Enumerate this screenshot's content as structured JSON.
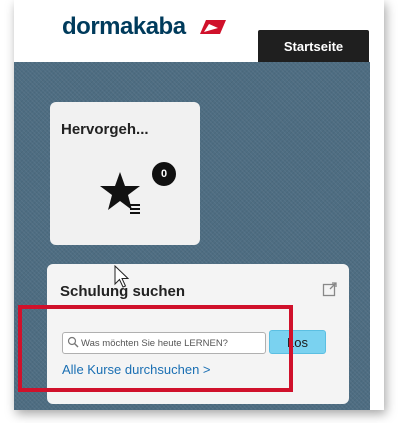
{
  "header": {
    "logo_text": "dormakaba",
    "tab_label": "Startseite"
  },
  "tile": {
    "title": "Hervorgeh...",
    "badge_count": "0",
    "icon": "star-list-icon"
  },
  "search_panel": {
    "title": "Schulung suchen",
    "search_placeholder": "Was möchten Sie heute LERNEN?",
    "go_label": "Los",
    "browse_link": "Alle Kurse durchsuchen >",
    "external_icon": "external-link-icon"
  },
  "colors": {
    "brand": "#003b5c",
    "accent_red": "#d0112b",
    "button": "#7ad2f0",
    "canvas": "#4e6d82"
  }
}
